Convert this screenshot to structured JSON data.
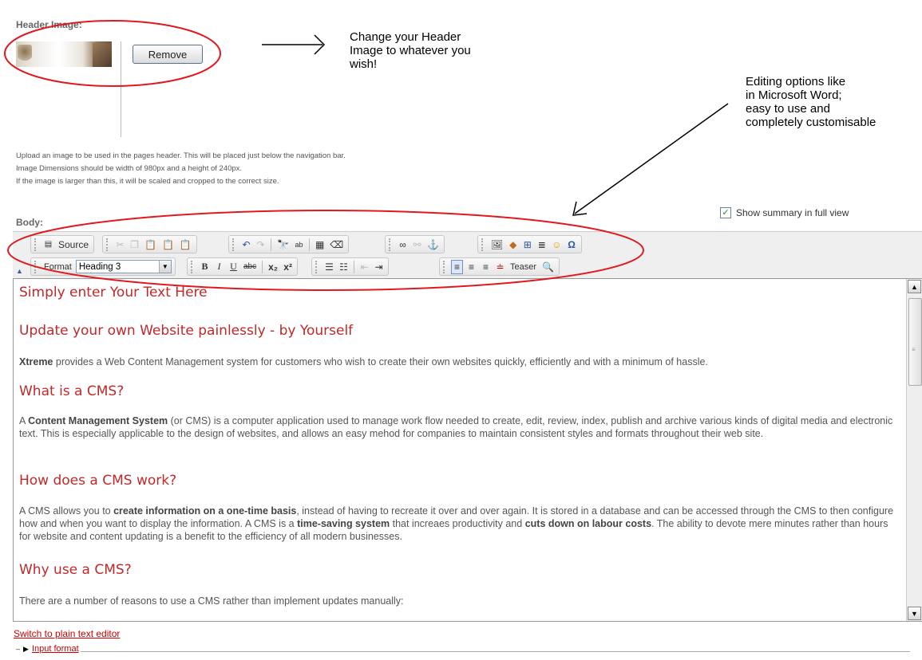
{
  "header_image": {
    "label": "Header Image:",
    "remove_label": "Remove",
    "help_lines": [
      "Upload an image to be used in the pages header. This will be placed just below the navigation bar.",
      "Image Dimensions should be width of 980px and a height of 240px.",
      "If the image is larger than this, it will be scaled and cropped to the correct size."
    ]
  },
  "annotations": {
    "header_callout": [
      "Change your Header",
      "Image to whatever you",
      "wish!"
    ],
    "editor_callout": [
      "Editing options like",
      "in Microsoft Word;",
      "easy to use and",
      "completely customisable"
    ],
    "color": "#e0191f"
  },
  "body": {
    "label": "Body:",
    "show_summary_label": "Show summary in full view",
    "show_summary_checked": true
  },
  "toolbar": {
    "source_label": "Source",
    "format_label": "Format",
    "format_value": "Heading 3",
    "teaser_label": "Teaser"
  },
  "content": {
    "h1": "Simply enter Your Text Here",
    "h2": "Update your own Website painlessly - by Yourself",
    "p1_bold": "Xtreme",
    "p1_rest": " provides a Web Content Management system for customers who wish to create their own websites quickly, efficiently and with a minimum of hassle.",
    "h3": "What is a CMS?",
    "p2_a": "A ",
    "p2_bold": "Content Management System",
    "p2_rest": " (or CMS) is a computer application used to manage work flow needed to create, edit, review, index, publish and archive various kinds of digital media and electronic text. This is especially applicable to the design of websites, and allows an easy mehod for companies to maintain consistent styles and formats throughout their web site.",
    "h4": "How does a CMS work?",
    "p3_a": "A CMS allows you to ",
    "p3_b1": "create information on a one-time basis",
    "p3_c": ", instead of having to recreate it over and over again. It is stored in a database and can be accessed through the CMS to then configure how and when you want to display the information. A CMS is a ",
    "p3_b2": "time-saving system",
    "p3_d": " that increaes productivity and ",
    "p3_b3": "cuts down on labour costs",
    "p3_e": ". The ability to devote mere minutes rather than hours for website and content updating is a benefit to the efficiency of all modern businesses.",
    "h5": "Why use a CMS?",
    "p4": "There are a number of reasons to use a CMS rather than implement updates manually:"
  },
  "footer": {
    "switch_link": "Switch to plain text editor",
    "input_format": "Input format"
  },
  "icons": [
    "source-icon",
    "cut-icon",
    "copy-icon",
    "paste-icon",
    "paste-text-icon",
    "paste-word-icon",
    "undo-icon",
    "redo-icon",
    "find-icon",
    "replace-icon",
    "select-all-icon",
    "remove-format-icon",
    "link-icon",
    "unlink-icon",
    "anchor-icon",
    "image-icon",
    "flash-icon",
    "table-icon",
    "horizontal-rule-icon",
    "smiley-icon",
    "special-char-icon",
    "bold-icon",
    "italic-icon",
    "underline-icon",
    "strike-icon",
    "subscript-icon",
    "superscript-icon",
    "numbered-list-icon",
    "bulleted-list-icon",
    "outdent-icon",
    "indent-icon",
    "align-left-icon",
    "align-center-icon",
    "align-right-icon",
    "teaser-icon",
    "preview-icon"
  ]
}
